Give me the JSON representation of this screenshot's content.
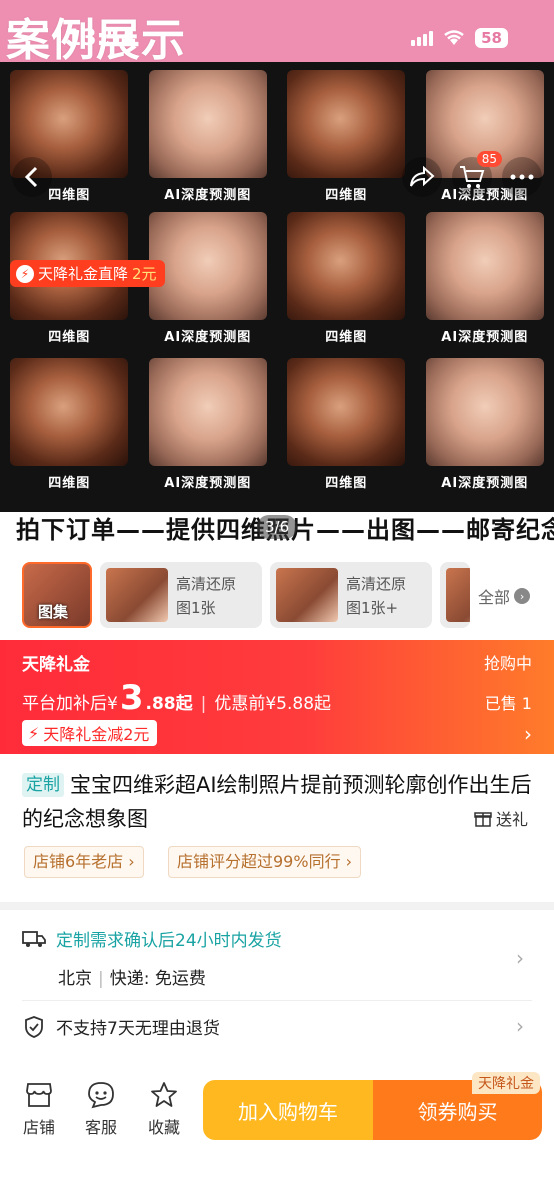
{
  "banner": {
    "title": "案例展示"
  },
  "status": {
    "time": "13:54",
    "battery": "58"
  },
  "hero": {
    "captions": [
      "四维图",
      "AI深度预测图",
      "四维图",
      "AI深度预测图"
    ],
    "promo": {
      "label": "天降礼金直降",
      "amount": "2元"
    },
    "caption_line": "拍下订单——提供四维照片——出图——邮寄纪念照片",
    "page_indicator": "3/6",
    "cart_count": "85"
  },
  "thumbs": {
    "gallery_label": "图集",
    "a_text_1": "高清还原",
    "a_text_2": "图1张",
    "b_text_1": "高清还原",
    "b_text_2": "图1张+",
    "see_all": "全部"
  },
  "price": {
    "title": "天降礼金",
    "status": "抢购中",
    "prefix": "平台加补后¥",
    "value": "3",
    "decimal": ".88起",
    "original": "优惠前¥5.88起",
    "sold": "已售 1",
    "coupon": "天降礼金减2元"
  },
  "product": {
    "tag": "定制",
    "title": "宝宝四维彩超AI绘制照片提前预测轮廓创作出生后的纪念想象图",
    "gift": "送礼",
    "chip_a": "店铺6年老店",
    "chip_b": "店铺评分超过99%同行"
  },
  "shipping": {
    "line1": "定制需求确认后24小时内发货",
    "origin": "北京",
    "express": "快递: 免运费",
    "returns": "不支持7天无理由退货"
  },
  "bottom": {
    "store": "店铺",
    "service": "客服",
    "favorite": "收藏",
    "add_cart": "加入购物车",
    "buy": "领券购买",
    "badge": "天降礼金"
  }
}
